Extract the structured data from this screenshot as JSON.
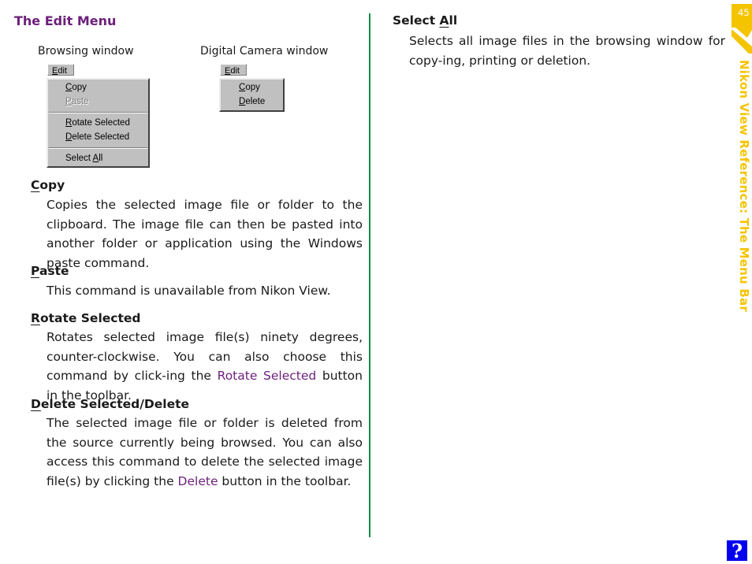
{
  "section_title": "The Edit Menu",
  "figures": {
    "browsing": {
      "caption": "Browsing window",
      "menu_bar_item": {
        "underline": "E",
        "rest": "dit"
      },
      "items": [
        {
          "underline": "C",
          "rest": "opy",
          "disabled": false
        },
        {
          "underline": "P",
          "rest": "aste",
          "disabled": true
        },
        {
          "separator": true
        },
        {
          "underline": "R",
          "rest": "otate Selected",
          "disabled": false
        },
        {
          "underline": "D",
          "rest": "elete Selected",
          "disabled": false
        },
        {
          "separator": true
        },
        {
          "prefix": "Select ",
          "underline": "A",
          "rest": "ll",
          "disabled": false
        }
      ]
    },
    "camera": {
      "caption": "Digital Camera window",
      "menu_bar_item": {
        "underline": "E",
        "rest": "dit"
      },
      "items": [
        {
          "underline": "C",
          "rest": "opy",
          "disabled": false
        },
        {
          "underline": "D",
          "rest": "elete",
          "disabled": false
        }
      ]
    }
  },
  "entries": {
    "copy": {
      "head_underline": "C",
      "head_rest": "opy",
      "body": "Copies the selected image file or folder to the clipboard. The image file can then be pasted into another folder or application using the Windows paste command."
    },
    "paste": {
      "head_underline": "P",
      "head_rest": "aste",
      "body": "This command is unavailable from Nikon View."
    },
    "rotate": {
      "head_underline": "R",
      "head_rest": "otate Selected",
      "body_before": "Rotates selected image file(s) ninety degrees, counter-clockwise. You can also choose this command by click-ing the ",
      "link": "Rotate Selected",
      "body_after": " button in the toolbar."
    },
    "delete": {
      "head_underline": "D",
      "head_rest": "elete Selected/Delete",
      "body_before": "The selected image file or folder is deleted from the source currently being browsed. You can also access this command to delete the selected image file(s) by clicking the ",
      "link": "Delete",
      "body_after": " button in the toolbar."
    },
    "select_all": {
      "head_prefix": "Select ",
      "head_underline": "A",
      "head_rest": "ll",
      "body": "Selects all image files in the browsing window for copy-ing, printing or deletion."
    }
  },
  "sidebar": {
    "page_number": "45",
    "chapter_title": "Nikon View Reference: The Menu Bar"
  },
  "help_button": {
    "label": "?"
  },
  "colors": {
    "title_purple": "#6b1f7a",
    "divider_green": "#108a4a",
    "tab_yellow": "#f5c400",
    "help_blue": "#0000ee"
  }
}
